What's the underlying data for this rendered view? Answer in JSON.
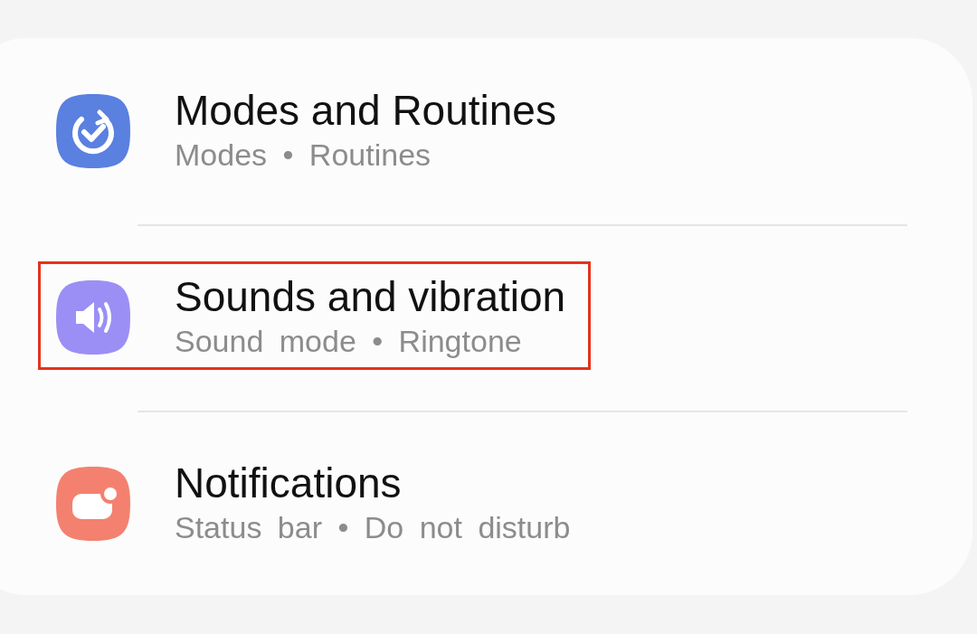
{
  "items": [
    {
      "kind": "routines",
      "title": "Modes and Routines",
      "subtitle": "Modes • Routines",
      "color": "#5a80e0",
      "highlighted": false
    },
    {
      "kind": "sound",
      "title": "Sounds and vibration",
      "subtitle": "Sound mode • Ringtone",
      "color": "#9b8ff6",
      "highlighted": true
    },
    {
      "kind": "notifications",
      "title": "Notifications",
      "subtitle": "Status bar • Do not disturb",
      "color": "#f4816f",
      "highlighted": false
    }
  ]
}
